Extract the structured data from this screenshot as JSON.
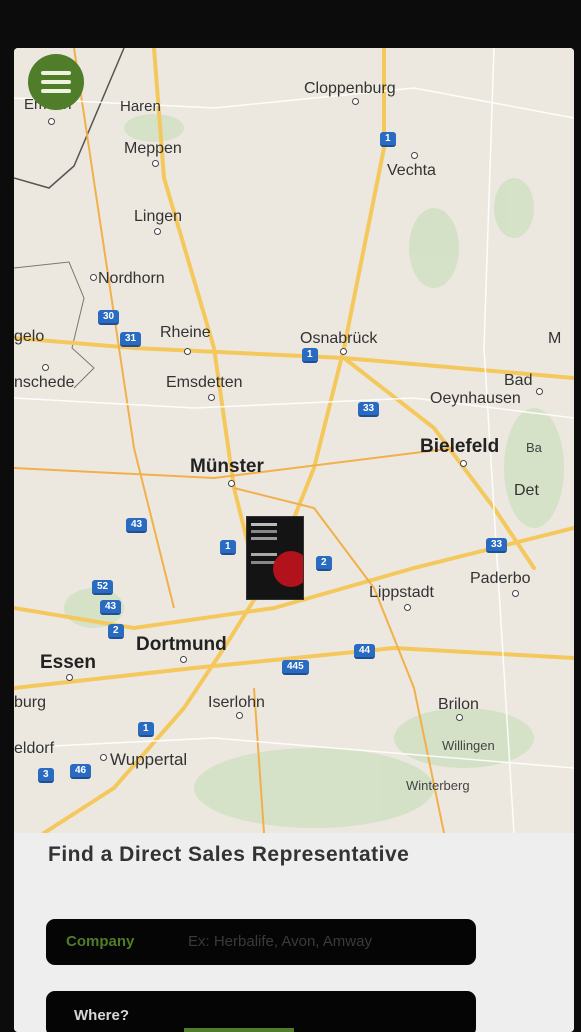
{
  "menu": {
    "icon": "hamburger-menu-icon"
  },
  "map": {
    "cities": [
      {
        "id": "emden",
        "name": "Emden",
        "cls": "small"
      },
      {
        "id": "haren",
        "name": "Haren",
        "cls": "small"
      },
      {
        "id": "cloppenburg",
        "name": "Cloppenburg",
        "cls": ""
      },
      {
        "id": "meppen",
        "name": "Meppen",
        "cls": ""
      },
      {
        "id": "vechta",
        "name": "Vechta",
        "cls": ""
      },
      {
        "id": "lingen",
        "name": "Lingen",
        "cls": ""
      },
      {
        "id": "nordhorn",
        "name": "Nordhorn",
        "cls": ""
      },
      {
        "id": "gelo",
        "name": "gelo",
        "cls": ""
      },
      {
        "id": "rheine",
        "name": "Rheine",
        "cls": ""
      },
      {
        "id": "osnabruck",
        "name": "Osnabrück",
        "cls": ""
      },
      {
        "id": "m-edge",
        "name": "M",
        "cls": ""
      },
      {
        "id": "nschede",
        "name": "nschede",
        "cls": ""
      },
      {
        "id": "emsdetten",
        "name": "Emsdetten",
        "cls": ""
      },
      {
        "id": "bad-oeynhausen-1",
        "name": "Bad",
        "cls": ""
      },
      {
        "id": "bad-oeynhausen-2",
        "name": "Oeynhausen",
        "cls": ""
      },
      {
        "id": "bielefeld",
        "name": "Bielefeld",
        "cls": "big"
      },
      {
        "id": "ba",
        "name": "Ba",
        "cls": "small"
      },
      {
        "id": "munster",
        "name": "Münster",
        "cls": "big"
      },
      {
        "id": "det",
        "name": "Det",
        "cls": ""
      },
      {
        "id": "paderbo",
        "name": "Paderbo",
        "cls": ""
      },
      {
        "id": "lippstadt",
        "name": "Lippstadt",
        "cls": ""
      },
      {
        "id": "dortmund",
        "name": "Dortmund",
        "cls": "big"
      },
      {
        "id": "essen",
        "name": "Essen",
        "cls": "big"
      },
      {
        "id": "burg",
        "name": "burg",
        "cls": ""
      },
      {
        "id": "iserlohn",
        "name": "Iserlohn",
        "cls": ""
      },
      {
        "id": "brilon",
        "name": "Brilon",
        "cls": ""
      },
      {
        "id": "eldorf",
        "name": "eldorf",
        "cls": ""
      },
      {
        "id": "wuppertal",
        "name": "Wuppertal",
        "cls": ""
      },
      {
        "id": "willingen",
        "name": "Willingen",
        "cls": "small"
      },
      {
        "id": "winterberg",
        "name": "Winterberg",
        "cls": "small"
      }
    ],
    "shields": [
      "1",
      "30",
      "31",
      "1",
      "33",
      "43",
      "1",
      "2",
      "33",
      "52",
      "43",
      "2",
      "44",
      "445",
      "1",
      "46",
      "3"
    ],
    "marker": {
      "name": "representative-marker"
    }
  },
  "panel": {
    "title": "Find a Direct Sales Representative",
    "company_label": "Company",
    "company_placeholder": "Ex: Herbalife, Avon, Amway",
    "where_label": "Where?"
  },
  "colors": {
    "accent": "#4f7d2a",
    "field_bg": "#050505",
    "highway_blue": "#2a6bc2",
    "road_yellow": "#f4c85c"
  }
}
